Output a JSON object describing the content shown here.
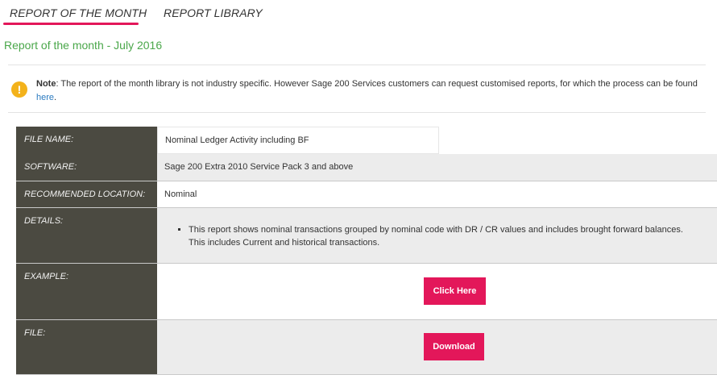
{
  "tabs": [
    {
      "label": "REPORT OF THE MONTH",
      "active": true
    },
    {
      "label": "REPORT LIBRARY",
      "active": false
    }
  ],
  "page_title": "Report of the month - July 2016",
  "note": {
    "icon": "exclamation-icon",
    "bold": "Note",
    "text": ": The report of the month library is not industry specific. However Sage 200 Services customers can request customised reports, for which the process can be found ",
    "link": "here",
    "end": "."
  },
  "rows": {
    "file_name": {
      "label": "FILE NAME:",
      "value": "Nominal Ledger Activity including BF"
    },
    "software": {
      "label": "SOFTWARE:",
      "value": "Sage 200 Extra 2010 Service Pack 3 and above"
    },
    "location": {
      "label": "RECOMMENDED LOCATION:",
      "value": "Nominal"
    },
    "details": {
      "label": "DETAILS:",
      "bullet": "This report shows nominal transactions grouped by nominal code with DR / CR values and includes brought forward balances. This includes Current and historical transactions."
    },
    "example": {
      "label": "EXAMPLE:",
      "button": "Click Here"
    },
    "file": {
      "label": "FILE:",
      "button": "Download"
    }
  },
  "colors": {
    "accent": "#e3175a",
    "title_green": "#4aa74a",
    "label_bg": "#4b4a41",
    "warning": "#f3b21b",
    "link": "#2b7bc0"
  }
}
